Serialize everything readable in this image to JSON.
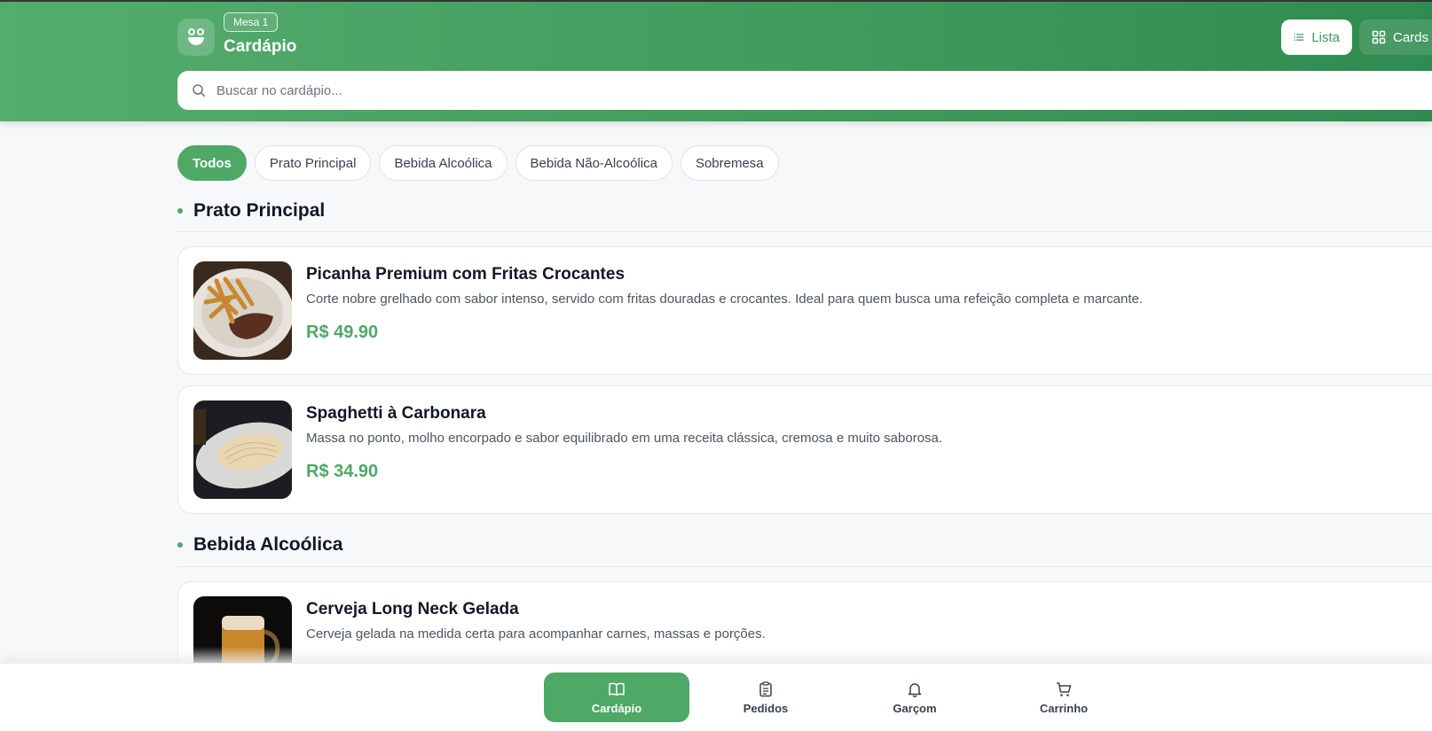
{
  "header": {
    "table_badge": "Mesa 1",
    "title": "Cardápio",
    "view_list_label": "Lista",
    "view_cards_label": "Cards",
    "search_placeholder": "Buscar no cardápio..."
  },
  "categories": [
    {
      "label": "Todos",
      "active": true
    },
    {
      "label": "Prato Principal",
      "active": false
    },
    {
      "label": "Bebida Alcoólica",
      "active": false
    },
    {
      "label": "Bebida Não-Alcoólica",
      "active": false
    },
    {
      "label": "Sobremesa",
      "active": false
    }
  ],
  "sections": [
    {
      "title": "Prato Principal",
      "items": [
        {
          "name": "Picanha Premium com Fritas Crocantes",
          "description": "Corte nobre grelhado com sabor intenso, servido com fritas douradas e crocantes. Ideal para quem busca uma refeição completa e marcante.",
          "price": "R$ 49.90"
        },
        {
          "name": "Spaghetti à Carbonara",
          "description": "Massa no ponto, molho encorpado e sabor equilibrado em uma receita clássica, cremosa e muito saborosa.",
          "price": "R$ 34.90"
        }
      ]
    },
    {
      "title": "Bebida Alcoólica",
      "items": [
        {
          "name": "Cerveja Long Neck Gelada",
          "description": "Cerveja gelada na medida certa para acompanhar carnes, massas e porções."
        }
      ]
    }
  ],
  "bottom_nav": [
    {
      "label": "Cardápio",
      "icon": "book-open-icon",
      "active": true
    },
    {
      "label": "Pedidos",
      "icon": "clipboard-icon",
      "active": false
    },
    {
      "label": "Garçom",
      "icon": "bell-icon",
      "active": false
    },
    {
      "label": "Carrinho",
      "icon": "cart-icon",
      "active": false
    }
  ],
  "colors": {
    "brand": "#4ea866",
    "header_dark": "#2f8b4f",
    "text": "#111827"
  }
}
